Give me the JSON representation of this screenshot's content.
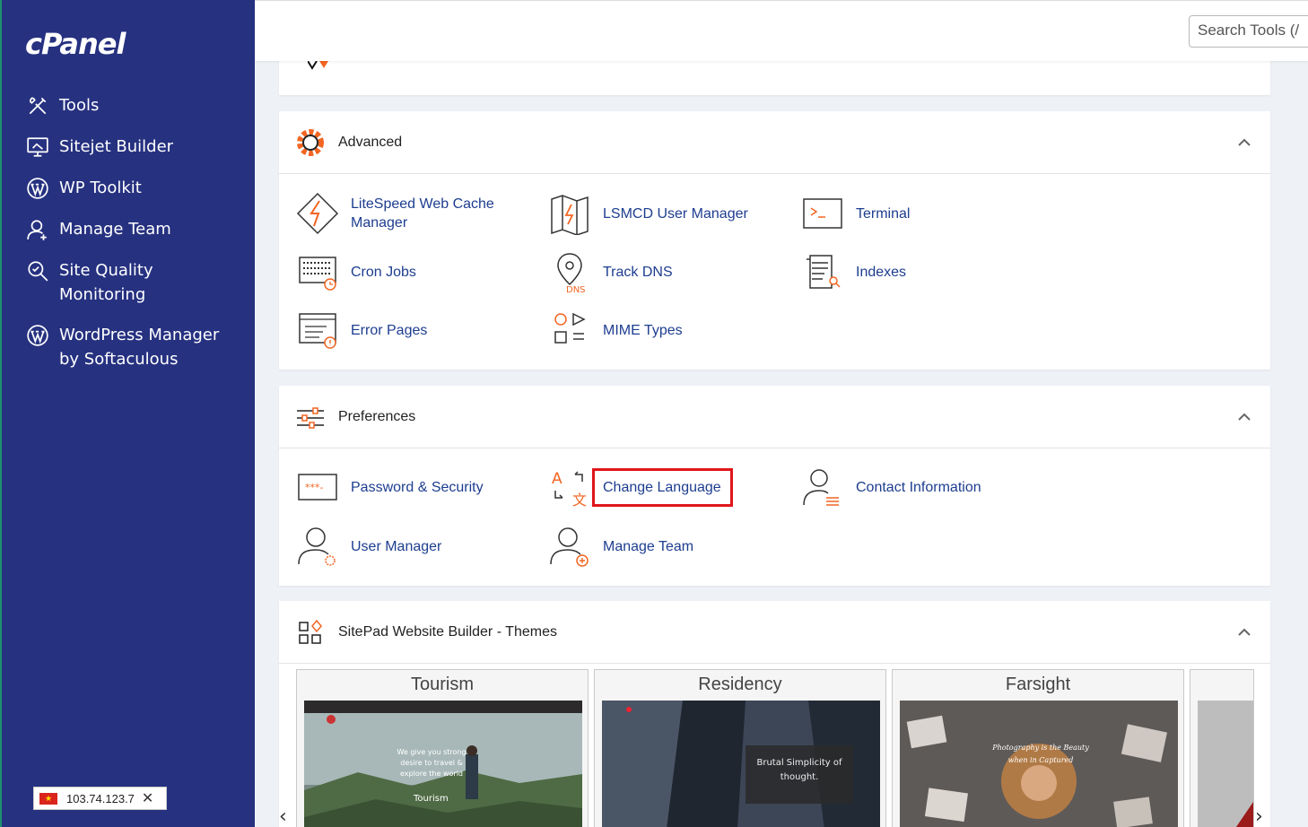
{
  "sidebar": {
    "logo": "cPanel",
    "items": [
      {
        "label": "Tools",
        "icon": "tools-icon"
      },
      {
        "label": "Sitejet Builder",
        "icon": "monitor-icon"
      },
      {
        "label": "WP Toolkit",
        "icon": "wordpress-icon"
      },
      {
        "label": "Manage Team",
        "icon": "team-icon"
      },
      {
        "label": "Site Quality Monitoring",
        "icon": "magnifier-icon"
      },
      {
        "label": "WordPress Manager by Softaculous",
        "icon": "wordpress-icon"
      }
    ],
    "ip": "103.74.123.7"
  },
  "search": {
    "placeholder": "Search Tools (/"
  },
  "sections": {
    "advanced": {
      "title": "Advanced",
      "items": [
        {
          "label": "LiteSpeed Web Cache Manager"
        },
        {
          "label": "LSMCD User Manager"
        },
        {
          "label": "Terminal"
        },
        {
          "label": "Cron Jobs"
        },
        {
          "label": "Track DNS"
        },
        {
          "label": "Indexes"
        },
        {
          "label": "Error Pages"
        },
        {
          "label": "MIME Types"
        }
      ]
    },
    "preferences": {
      "title": "Preferences",
      "items": [
        {
          "label": "Password & Security"
        },
        {
          "label": "Change Language"
        },
        {
          "label": "Contact Information"
        },
        {
          "label": "User Manager"
        },
        {
          "label": "Manage Team"
        }
      ]
    },
    "sitepad": {
      "title": "SitePad Website Builder - Themes",
      "themes": [
        {
          "name": "Tourism",
          "caption": "We give you strong desire to travel & explore the world",
          "sub": "Tourism"
        },
        {
          "name": "Residency",
          "caption": "Brutal Simplicity of thought."
        },
        {
          "name": "Farsight",
          "caption": "Photography is the Beauty when in Captured"
        }
      ]
    }
  },
  "colors": {
    "sidebar": "#263180",
    "accent": "#f26522",
    "link": "#1d3d8f",
    "highlight": "#e0161b"
  }
}
